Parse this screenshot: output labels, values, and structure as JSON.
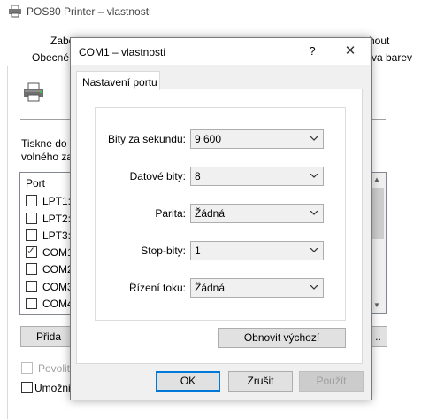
{
  "background_window": {
    "title": "POS80 Printer – vlastnosti",
    "tabs_row1": [
      "Zabe",
      "hout"
    ],
    "tabs_row2": [
      "Obecné",
      "va barev"
    ],
    "desc_line1": "Tiskne do n",
    "desc_line2": "volného za",
    "port_header": "Port",
    "ports": [
      {
        "label": "LPT1:",
        "checked": false
      },
      {
        "label": "LPT2:",
        "checked": false
      },
      {
        "label": "LPT3:",
        "checked": false
      },
      {
        "label": "COM1",
        "checked": true
      },
      {
        "label": "COM2",
        "checked": false
      },
      {
        "label": "COM3",
        "checked": false
      },
      {
        "label": "COM4",
        "checked": false
      }
    ],
    "add_button": "Přida",
    "more_button": "..",
    "allow_label": "Povolit",
    "enable_label": "Umožni"
  },
  "dialog": {
    "title": "COM1 – vlastnosti",
    "help_glyph": "?",
    "close_glyph": "✕",
    "tab": "Nastavení portu",
    "fields": [
      {
        "label": "Bity za sekundu:",
        "value": "9 600"
      },
      {
        "label": "Datové bity:",
        "value": "8"
      },
      {
        "label": "Parita:",
        "value": "Žádná"
      },
      {
        "label": "Stop-bity:",
        "value": "1"
      },
      {
        "label": "Řízení toku:",
        "value": "Žádná"
      }
    ],
    "restore_button": "Obnovit výchozí",
    "ok_button": "OK",
    "cancel_button": "Zrušit",
    "apply_button": "Použít"
  },
  "icons": {
    "printer": "printer-icon",
    "dropdown": "chevron-down-icon",
    "close": "close-icon",
    "help": "help-icon"
  },
  "colors": {
    "accent": "#0078d7",
    "window_bg": "#f0f0f0",
    "button_bg": "#e1e1e1"
  }
}
